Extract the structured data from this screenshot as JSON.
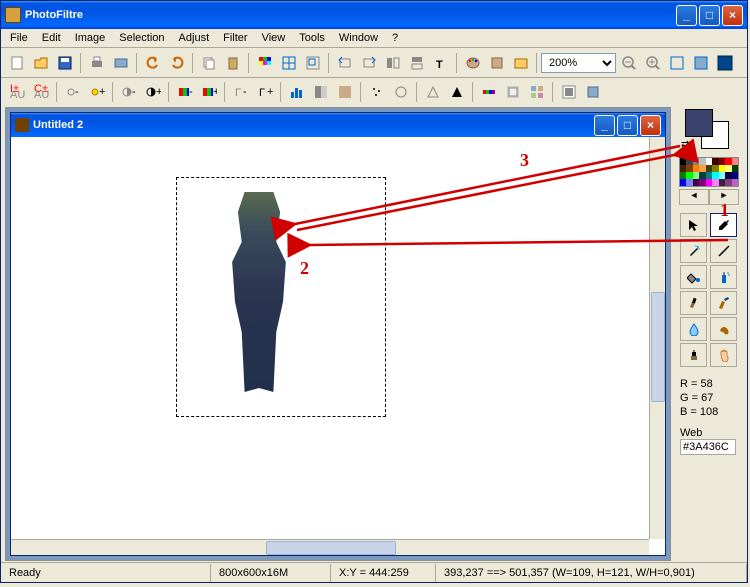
{
  "app": {
    "title": "PhotoFiltre"
  },
  "menu": {
    "items": [
      "File",
      "Edit",
      "Image",
      "Selection",
      "Adjust",
      "Filter",
      "View",
      "Tools",
      "Window",
      "?"
    ]
  },
  "toolbar": {
    "zoom_value": "200%",
    "icons": [
      "new",
      "open",
      "save",
      "print",
      "scan",
      "undo",
      "redo",
      "copy",
      "paste",
      "grid1",
      "grid2",
      "grid3",
      "rotl",
      "rotr",
      "flip",
      "flop",
      "text",
      "palette",
      "brush",
      "folder",
      "mag"
    ],
    "icons2": [
      "auto1",
      "auto2",
      "bright-",
      "bright+",
      "cont-",
      "cont+",
      "gamma-",
      "gamma+",
      "sat-",
      "sat+",
      "gray",
      "sepia",
      "hist",
      "posterize",
      "solarize",
      "sharp",
      "soft",
      "dust",
      "relief",
      "tri1",
      "tri2",
      "tri3",
      "tri4"
    ]
  },
  "doc": {
    "title": "Untitled 2"
  },
  "sidebar": {
    "fg_color": "#3a436c",
    "bg_color": "#ffffff",
    "palette": [
      "#000",
      "#404040",
      "#808080",
      "#c0c0c0",
      "#fff",
      "#400000",
      "#800000",
      "#ff0000",
      "#ff8080",
      "#402000",
      "#804000",
      "#ff8000",
      "#ffa040",
      "#404000",
      "#808000",
      "#ffff00",
      "#ffff80",
      "#004000",
      "#008000",
      "#00ff00",
      "#80ff80",
      "#004040",
      "#008080",
      "#00ffff",
      "#80ffff",
      "#000040",
      "#000080",
      "#0000ff",
      "#8080ff",
      "#400040",
      "#800080",
      "#ff00ff",
      "#ff80ff",
      "#402040",
      "#804080",
      "#c060c0"
    ],
    "tools": [
      "pointer",
      "eyedropper",
      "wand",
      "line",
      "bucket",
      "spray",
      "brush",
      "pencil",
      "blur",
      "smudge",
      "clone",
      "hand"
    ],
    "rgb": {
      "r_label": "R = 58",
      "g_label": "G = 67",
      "b_label": "B = 108"
    },
    "web_label": "Web",
    "web_value": "#3A436C"
  },
  "status": {
    "ready": "Ready",
    "dim": "800x600x16M",
    "xy": "X:Y = 444:259",
    "sel": "393,237 ==> 501,357 (W=109, H=121, W/H=0,901)"
  },
  "annot": {
    "a1": "1",
    "a2": "2",
    "a3": "3"
  }
}
